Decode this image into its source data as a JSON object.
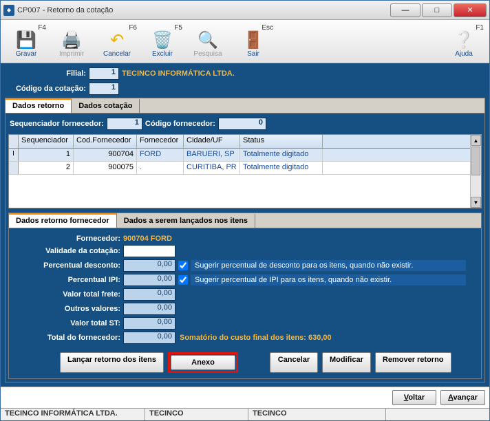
{
  "window": {
    "title": "CP007 - Retorno da cotação",
    "icon_name": "app-icon"
  },
  "toolbar": {
    "gravar": {
      "label": "Gravar",
      "key": "F4",
      "icon": "save-icon"
    },
    "imprimir": {
      "label": "Imprimir",
      "key": "",
      "icon": "print-icon"
    },
    "cancelar": {
      "label": "Cancelar",
      "key": "F6",
      "icon": "undo-icon"
    },
    "excluir": {
      "label": "Excluir",
      "key": "F5",
      "icon": "trash-icon"
    },
    "pesquisa": {
      "label": "Pesquisa",
      "key": "",
      "icon": "search-icon"
    },
    "sair": {
      "label": "Sair",
      "key": "Esc",
      "icon": "exit-icon"
    },
    "ajuda": {
      "label": "Ajuda",
      "key": "F1",
      "icon": "help-icon"
    }
  },
  "header": {
    "filial_label": "Filial:",
    "filial_value": "1",
    "filial_name": "TECINCO INFORMÁTICA LTDA.",
    "codigo_label": "Código da cotação:",
    "codigo_value": "1"
  },
  "tabs": {
    "retorno": "Dados retorno",
    "cotacao": "Dados cotação"
  },
  "seq": {
    "seq_label": "Sequenciador fornecedor:",
    "seq_value": "1",
    "cod_label": "Código fornecedor:",
    "cod_value": "0"
  },
  "grid": {
    "headers": {
      "seq": "Sequenciador",
      "cod": "Cod.Fornecedor",
      "forn": "Fornecedor",
      "cidade": "Cidade/UF",
      "status": "Status"
    },
    "rows": [
      {
        "seq": "1",
        "cod": "900704",
        "forn": "FORD",
        "cidade": "BARUERI, SP",
        "status": "Totalmente digitado"
      },
      {
        "seq": "2",
        "cod": "900075",
        "forn": ".",
        "cidade": "CURITIBA, PR",
        "status": "Totalmente digitado"
      }
    ]
  },
  "sub_tabs": {
    "ret_forn": "Dados retorno fornecedor",
    "lanc": "Dados a serem lançados nos itens"
  },
  "form": {
    "fornecedor_label": "Fornecedor:",
    "fornecedor_value": "900704  FORD",
    "validade_label": "Validade da cotação:",
    "validade_value": "",
    "perc_desc_label": "Percentual desconto:",
    "perc_desc_value": "0,00",
    "perc_desc_hint": "Sugerir percentual de desconto para os itens, quando não existir.",
    "perc_ipi_label": "Percentual IPI:",
    "perc_ipi_value": "0,00",
    "perc_ipi_hint": "Sugerir percentual de IPI para os itens, quando não existir.",
    "frete_label": "Valor total frete:",
    "frete_value": "0,00",
    "outros_label": "Outros valores:",
    "outros_value": "0,00",
    "st_label": "Valor total ST:",
    "st_value": "0,00",
    "total_label": "Total do fornecedor:",
    "total_value": "0,00",
    "total_hint": "Somatório do custo final dos itens:  630,00"
  },
  "buttons": {
    "lancar": "Lançar retorno dos itens",
    "anexo": "Anexo",
    "cancelar": "Cancelar",
    "modificar": "Modificar",
    "remover": "Remover retorno",
    "voltar": "Voltar",
    "avancar": "Avançar"
  },
  "statusbar": {
    "c1": "TECINCO INFORMÁTICA LTDA.",
    "c2": "TECINCO",
    "c3": "TECINCO"
  }
}
